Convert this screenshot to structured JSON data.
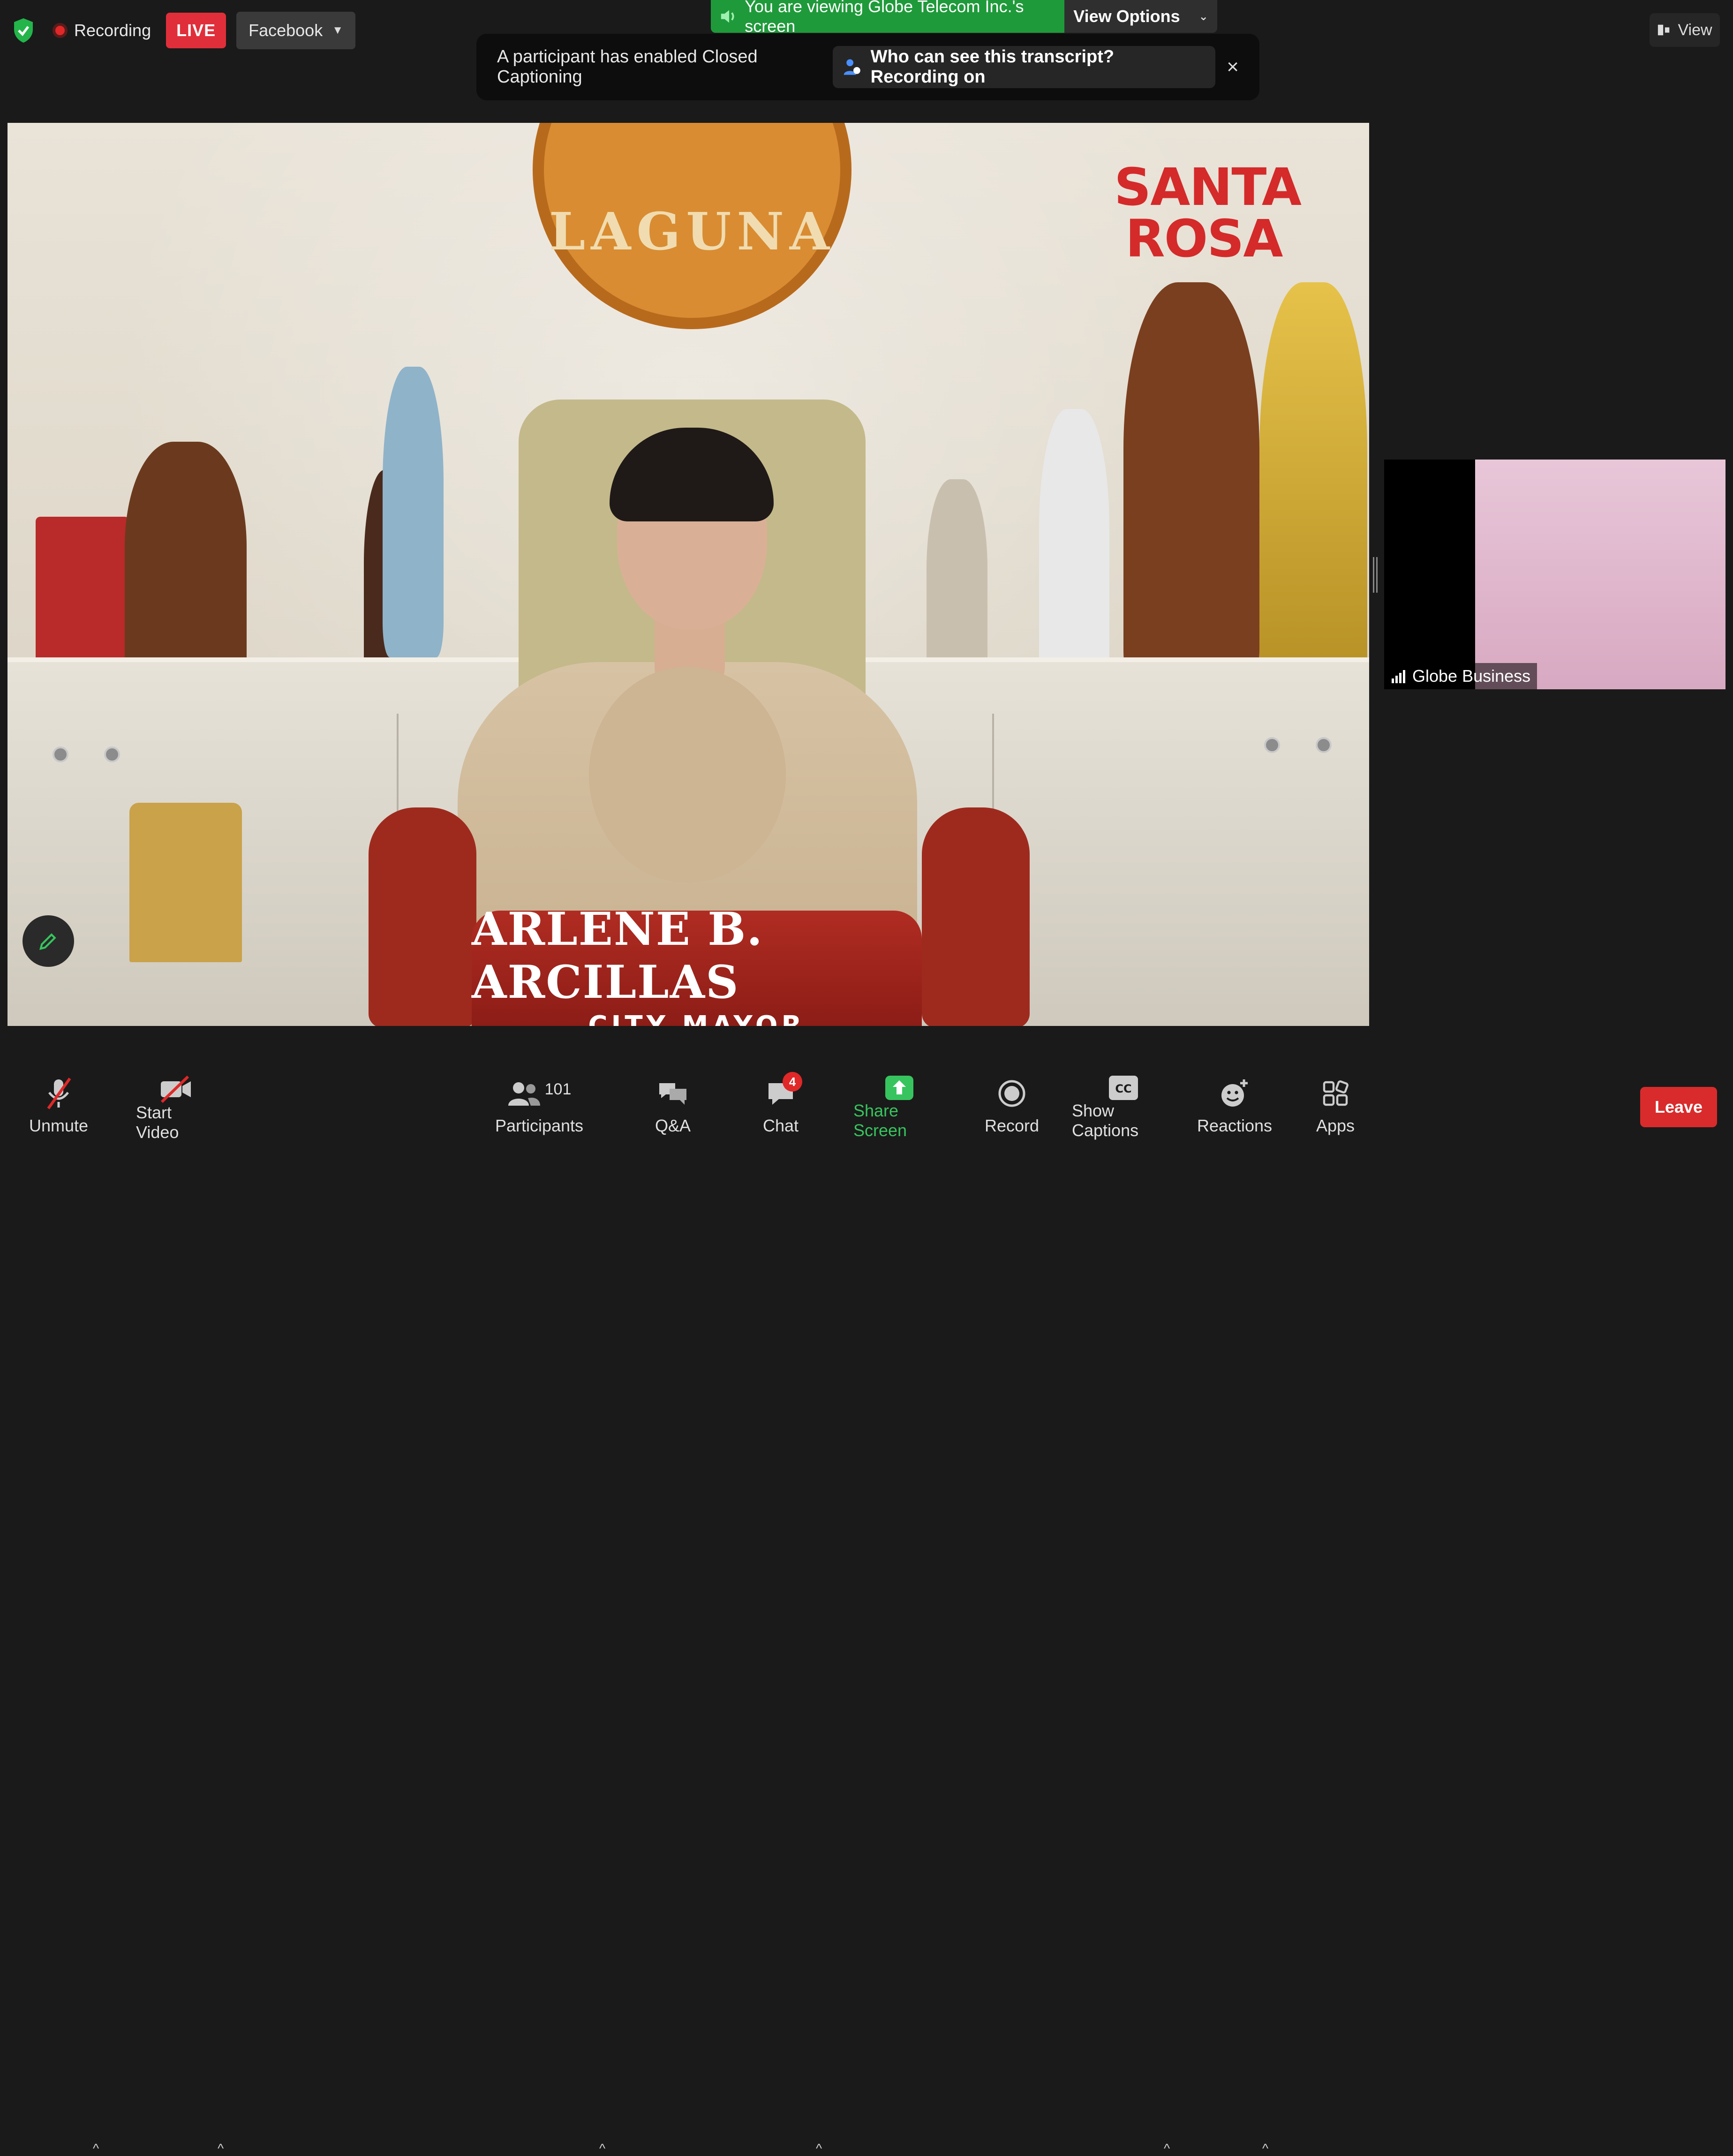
{
  "top_bar": {
    "recording_label": "Recording",
    "live_badge": "LIVE",
    "stream_target": "Facebook",
    "viewing_notice": "You are viewing Globe Telecom Inc.'s screen",
    "view_options_label": "View Options",
    "view_label": "View"
  },
  "caption_banner": {
    "message": "A participant has enabled Closed Captioning",
    "link_label": "Who can see this transcript? Recording on",
    "close_glyph": "×"
  },
  "main_video": {
    "seal_text": "LAGUNA",
    "logo_line1": "SANTA",
    "logo_line2": "ROSA",
    "name_plate": "ARLENE B. ARCILLAS",
    "name_title": "CITY MAYOR"
  },
  "thumbnail": {
    "participant_name": "Globe Business"
  },
  "toolbar": {
    "unmute": "Unmute",
    "start_video": "Start Video",
    "participants": "Participants",
    "participants_count": "101",
    "qa": "Q&A",
    "chat": "Chat",
    "chat_badge": "4",
    "share_screen": "Share Screen",
    "record": "Record",
    "show_captions": "Show Captions",
    "reactions": "Reactions",
    "apps": "Apps",
    "leave": "Leave"
  },
  "colors": {
    "accent_green": "#37c45e",
    "live_red": "#e02f3a",
    "leave_red": "#d92b2b",
    "banner_green": "#1f9a3a"
  }
}
